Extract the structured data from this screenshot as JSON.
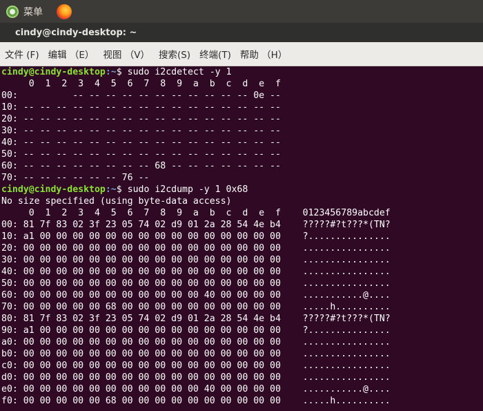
{
  "top_panel": {
    "menu_label": "菜单"
  },
  "window": {
    "title": "cindy@cindy-desktop: ~"
  },
  "menu_bar": {
    "items": [
      "文件 (F)",
      "编辑 （E）",
      "视图 （V）",
      "搜索(S)",
      "终端(T)",
      "帮助 （H）"
    ]
  },
  "terminal": {
    "prompt_user": "cindy@cindy-desktop",
    "prompt_path": ":~",
    "prompt_symbol": "$ ",
    "cmd1": "sudo i2cdetect -y 1",
    "detect_lines": [
      "     0  1  2  3  4  5  6  7  8  9  a  b  c  d  e  f",
      "00:          -- -- -- -- -- -- -- -- -- -- -- 0e -- ",
      "10: -- -- -- -- -- -- -- -- -- -- -- -- -- -- -- -- ",
      "20: -- -- -- -- -- -- -- -- -- -- -- -- -- -- -- -- ",
      "30: -- -- -- -- -- -- -- -- -- -- -- -- -- -- -- -- ",
      "40: -- -- -- -- -- -- -- -- -- -- -- -- -- -- -- -- ",
      "50: -- -- -- -- -- -- -- -- -- -- -- -- -- -- -- -- ",
      "60: -- -- -- -- -- -- -- -- 68 -- -- -- -- -- -- -- ",
      "70: -- -- -- -- -- -- 76 --"
    ],
    "cmd2": "sudo i2cdump -y 1 0x68",
    "dump_lines": [
      "No size specified (using byte-data access)",
      "     0  1  2  3  4  5  6  7  8  9  a  b  c  d  e  f    0123456789abcdef",
      "00: 81 7f 83 02 3f 23 05 74 02 d9 01 2a 28 54 4e b4    ?????#?t???*(TN?",
      "10: a1 00 00 00 00 00 00 00 00 00 00 00 00 00 00 00    ?...............",
      "20: 00 00 00 00 00 00 00 00 00 00 00 00 00 00 00 00    ................",
      "30: 00 00 00 00 00 00 00 00 00 00 00 00 00 00 00 00    ................",
      "40: 00 00 00 00 00 00 00 00 00 00 00 00 00 00 00 00    ................",
      "50: 00 00 00 00 00 00 00 00 00 00 00 00 00 00 00 00    ................",
      "60: 00 00 00 00 00 00 00 00 00 00 00 40 00 00 00 00    ...........@....",
      "70: 00 00 00 00 00 68 00 00 00 00 00 00 00 00 00 00    .....h..........",
      "80: 81 7f 83 02 3f 23 05 74 02 d9 01 2a 28 54 4e b4    ?????#?t???*(TN?",
      "90: a1 00 00 00 00 00 00 00 00 00 00 00 00 00 00 00    ?...............",
      "a0: 00 00 00 00 00 00 00 00 00 00 00 00 00 00 00 00    ................",
      "b0: 00 00 00 00 00 00 00 00 00 00 00 00 00 00 00 00    ................",
      "c0: 00 00 00 00 00 00 00 00 00 00 00 00 00 00 00 00    ................",
      "d0: 00 00 00 00 00 00 00 00 00 00 00 00 00 00 00 00    ................",
      "e0: 00 00 00 00 00 00 00 00 00 00 00 40 00 00 00 00    ...........@....",
      "f0: 00 00 00 00 00 68 00 00 00 00 00 00 00 00 00 00    .....h.........."
    ]
  }
}
